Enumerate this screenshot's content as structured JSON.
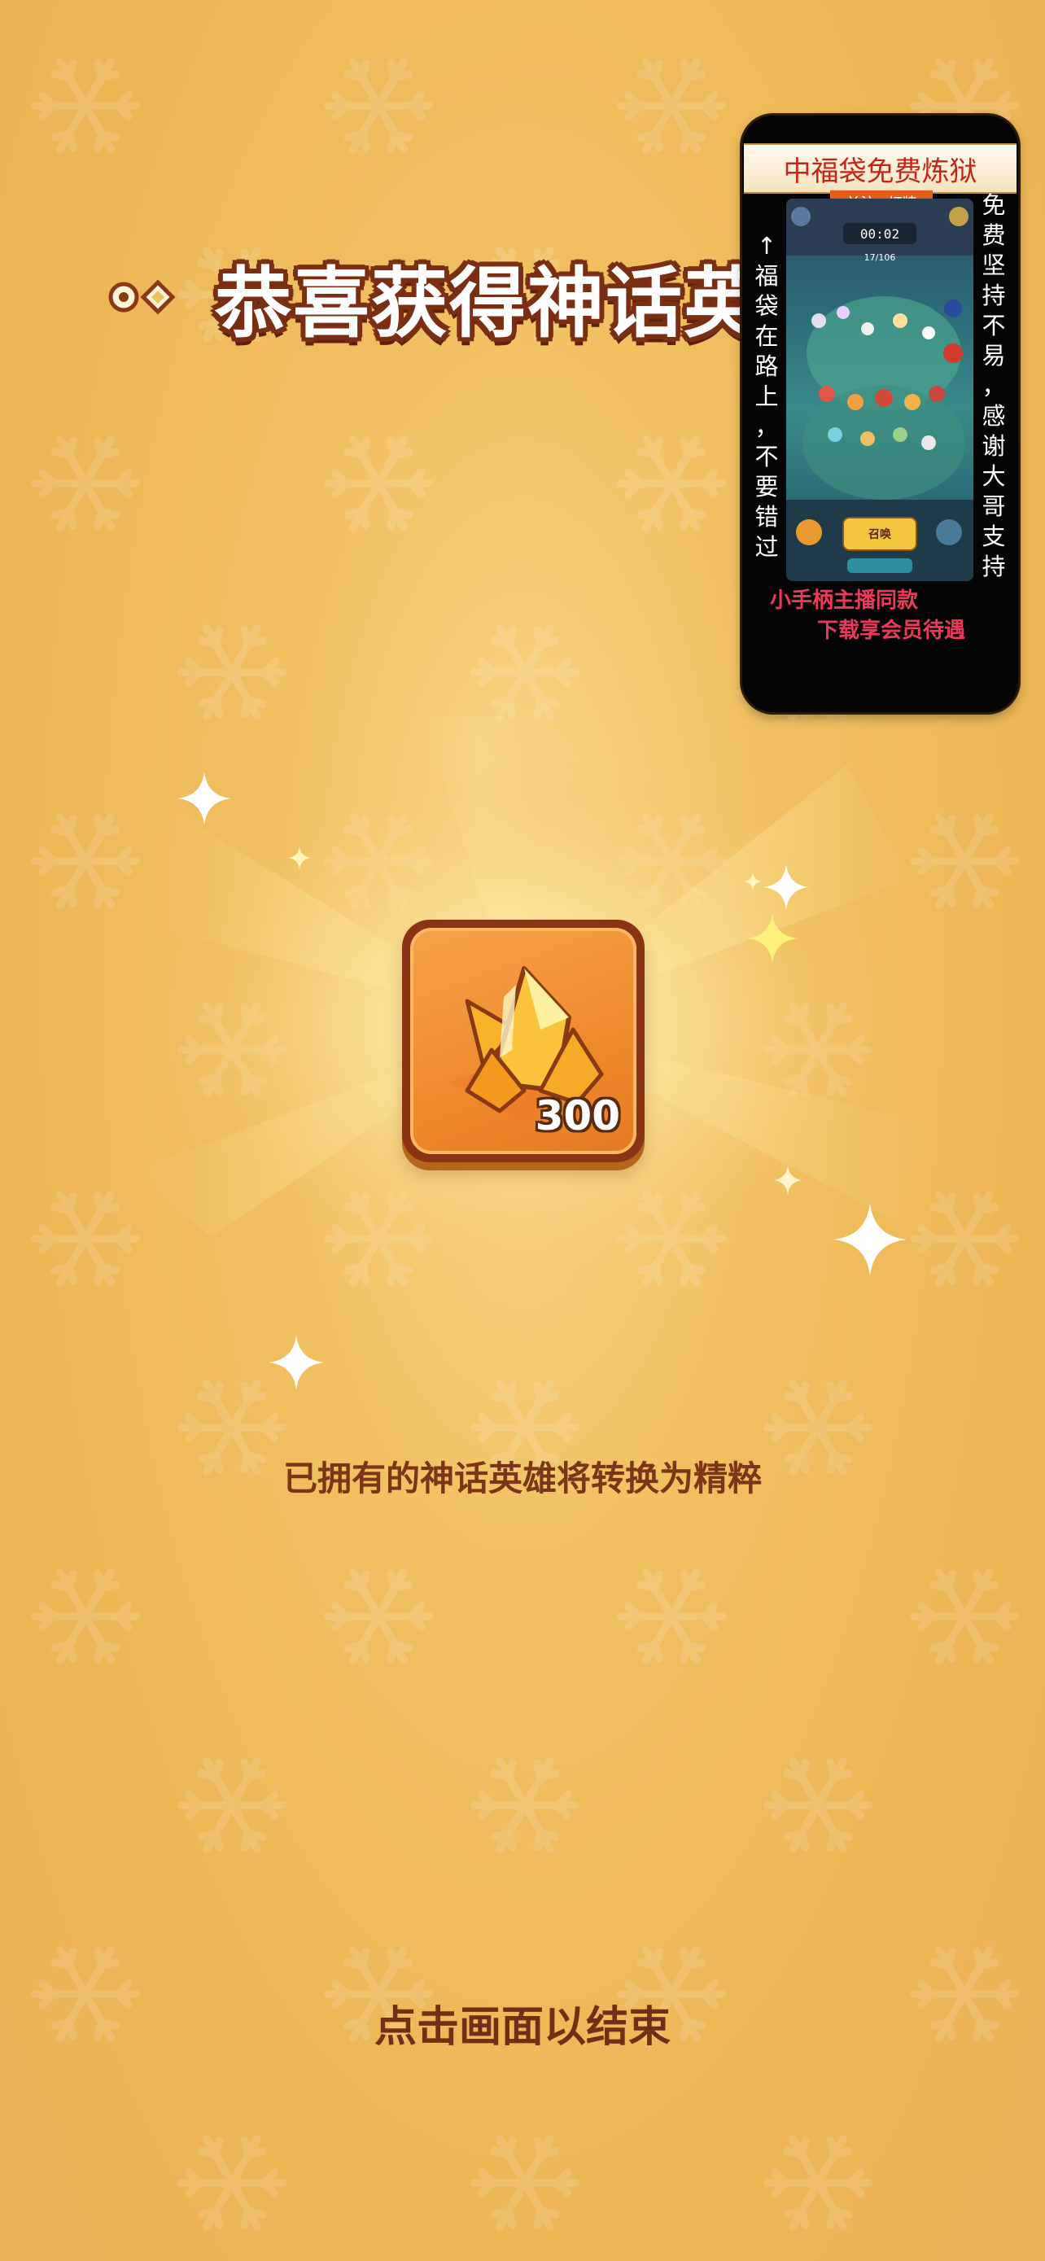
{
  "title": {
    "text": "恭喜获得神话英雄",
    "decor_icon": "circle-diamond-ornament-icon"
  },
  "reward": {
    "icon": "orange-crystal-essence-icon",
    "count": "300"
  },
  "note": "已拥有的神话英雄将转换为精粹",
  "prompt": "点击画面以结束",
  "ad": {
    "banner": "中福袋免费炼狱",
    "follow_tag": "关注+灯牌",
    "left_vertical": [
      "↑",
      "福",
      "袋",
      "在",
      "路",
      "上",
      "，",
      "不",
      "要",
      "错",
      "过"
    ],
    "right_vertical": [
      "免",
      "费",
      "坚",
      "持",
      "不",
      "易",
      "，",
      "感",
      "谢",
      "大",
      "哥",
      "支",
      "持"
    ],
    "game_preview": {
      "timer": "00:02",
      "wave": "17/106",
      "summon_label": "召唤"
    },
    "line1": "小手柄主播同款",
    "line2": "下载享会员待遇"
  },
  "colors": {
    "background": "#f1c061",
    "note_text": "#7a3617",
    "title_outline": "#7a2e12",
    "ad_text_pink": "#e63c5a",
    "banner_red": "#c1261a"
  }
}
